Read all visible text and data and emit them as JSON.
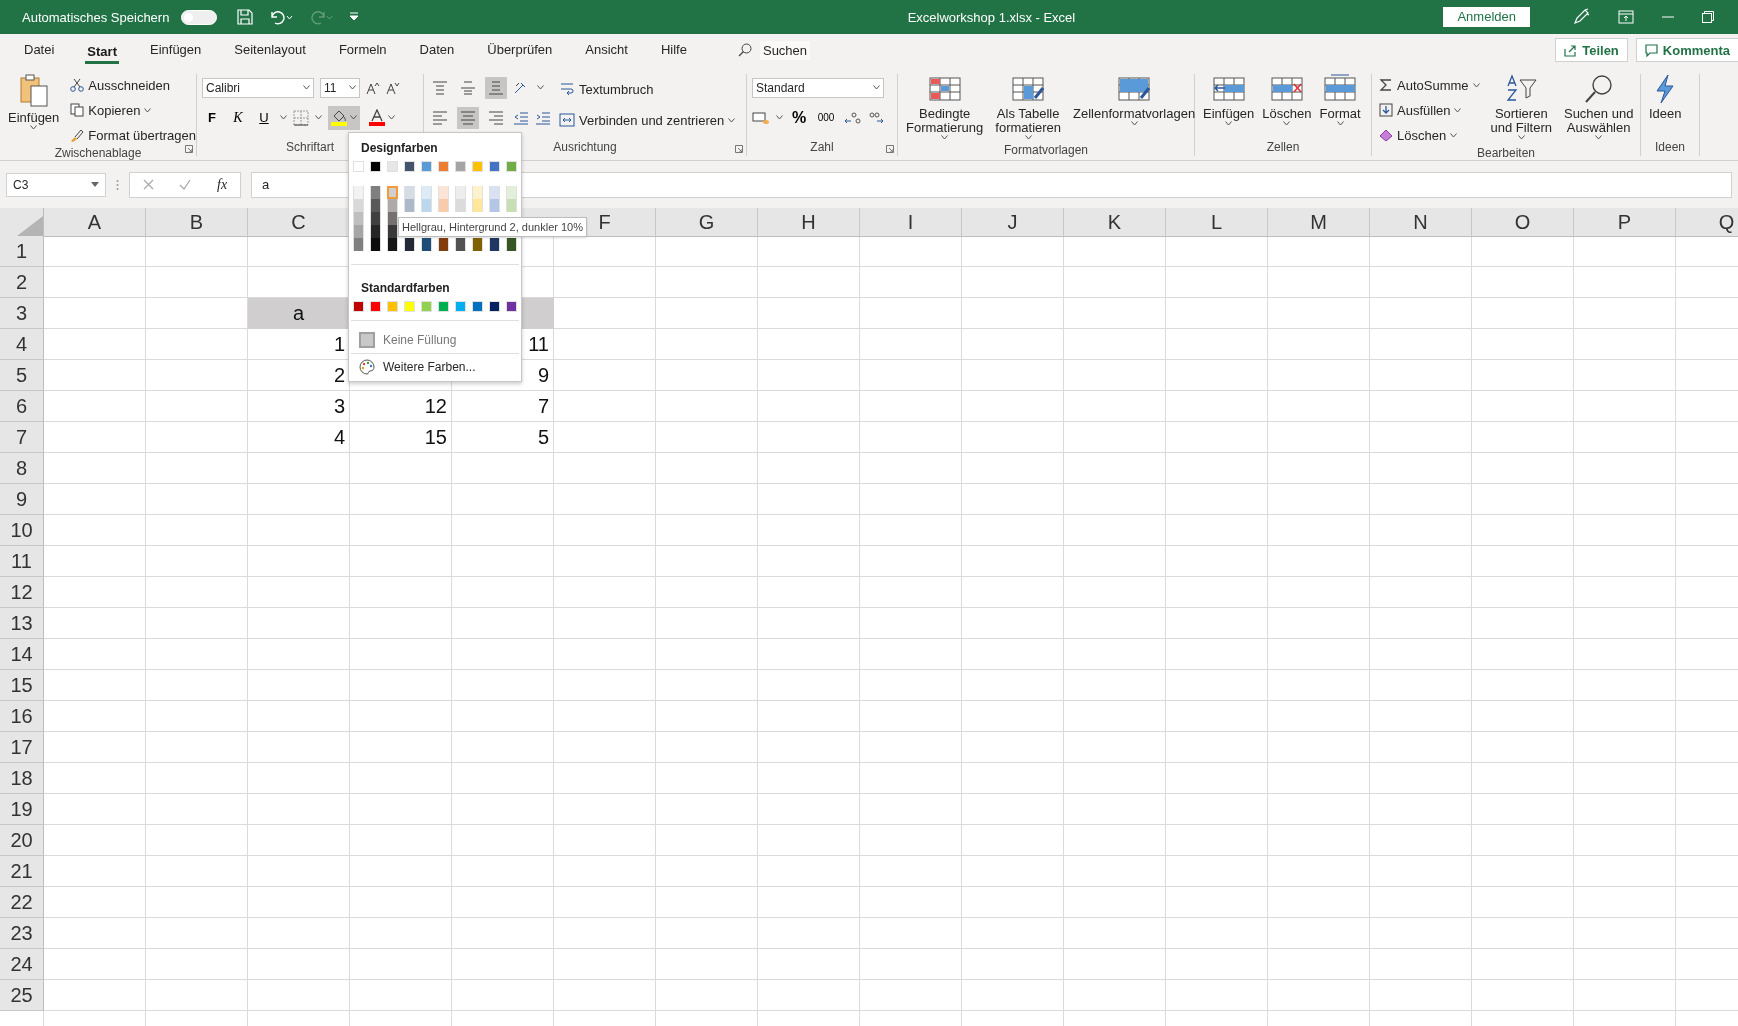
{
  "title_bar": {
    "autosave_label": "Automatisches Speichern",
    "autosave_on": false,
    "title": "Excelworkshop 1.xlsx  -  Excel",
    "sign_in": "Anmelden"
  },
  "menu_tabs": [
    {
      "label": "Datei",
      "selected": false
    },
    {
      "label": "Start",
      "selected": true
    },
    {
      "label": "Einfügen",
      "selected": false
    },
    {
      "label": "Seitenlayout",
      "selected": false
    },
    {
      "label": "Formeln",
      "selected": false
    },
    {
      "label": "Daten",
      "selected": false
    },
    {
      "label": "Überprüfen",
      "selected": false
    },
    {
      "label": "Ansicht",
      "selected": false
    },
    {
      "label": "Hilfe",
      "selected": false
    }
  ],
  "search": "Suchen",
  "share": "Teilen",
  "comments": "Kommenta",
  "ribbon": [
    {
      "kind": "clipboard",
      "label": "Zwischenablage",
      "paste": "Einfügen",
      "items": [
        "Ausschneiden",
        "Kopieren",
        "Format übertragen"
      ]
    },
    {
      "kind": "font",
      "label": "Schriftart",
      "font": "Calibri",
      "size": "11",
      "bold": "F",
      "italic": "K",
      "underline": "U",
      "fill_color": {
        "color": "#ffff00",
        "expanded": true
      },
      "font_color": {
        "color": "#ff0000"
      }
    },
    {
      "kind": "alignment",
      "label": "Ausrichtung",
      "vertical": [
        {
          "selected": false
        },
        {
          "selected": false
        },
        {
          "selected": true
        }
      ],
      "horizontal": [
        {
          "selected": false
        },
        {
          "selected": true
        },
        {
          "selected": false
        }
      ],
      "wrap": "Textumbruch",
      "merge": "Verbinden und zentrieren"
    },
    {
      "kind": "number",
      "label": "Zahl",
      "format": "Standard",
      "percent": "%",
      "thousands": "000"
    },
    {
      "kind": "styles",
      "label": "Formatvorlagen",
      "buttons": [
        "Bedingte\nFormatierung",
        "Als Tabelle\nformatieren",
        "Zellenformatvorlagen"
      ]
    },
    {
      "kind": "cells",
      "label": "Zellen",
      "buttons": [
        "Einfügen",
        "Löschen",
        "Format"
      ]
    },
    {
      "kind": "editing",
      "label": "Bearbeiten",
      "items": [
        "AutoSumme",
        "Ausfüllen",
        "Löschen"
      ],
      "buttons": [
        "Sortieren\nund Filtern",
        "Suchen und\nAuswählen"
      ]
    },
    {
      "kind": "ideas",
      "label": "Ideen",
      "buttons": [
        "Ideen"
      ]
    }
  ],
  "formula_bar": {
    "name_box": "C3",
    "function_label": "fx",
    "formula": "a"
  },
  "sheet": {
    "columns": [
      "A",
      "B",
      "C",
      null,
      null,
      "F",
      "G",
      "H",
      "I",
      "J",
      "K",
      "L",
      "M",
      "N",
      "O",
      "P",
      "Q"
    ],
    "rows": [
      {
        "number": "1"
      },
      {
        "number": "2"
      },
      {
        "number": "3",
        "cells": [
          null,
          null,
          {
            "value": "a",
            "kind": "text",
            "fill": true
          },
          null,
          {
            "fill": true
          }
        ]
      },
      {
        "number": "4",
        "cells": [
          null,
          null,
          {
            "value": "1",
            "kind": "number"
          },
          null,
          {
            "value": "11",
            "kind": "number"
          }
        ]
      },
      {
        "number": "5",
        "cells": [
          null,
          null,
          {
            "value": "2",
            "kind": "number"
          },
          null,
          {
            "value": "9",
            "kind": "number"
          }
        ]
      },
      {
        "number": "6",
        "cells": [
          null,
          null,
          {
            "value": "3",
            "kind": "number"
          },
          {
            "value": "12",
            "kind": "number"
          },
          {
            "value": "7",
            "kind": "number"
          }
        ]
      },
      {
        "number": "7",
        "cells": [
          null,
          null,
          {
            "value": "4",
            "kind": "number"
          },
          {
            "value": "15",
            "kind": "number"
          },
          {
            "value": "5",
            "kind": "number"
          }
        ]
      },
      {
        "number": "8"
      },
      {
        "number": "9"
      },
      {
        "number": "10"
      },
      {
        "number": "11"
      },
      {
        "number": "12"
      },
      {
        "number": "13"
      },
      {
        "number": "14"
      },
      {
        "number": "15"
      },
      {
        "number": "16"
      },
      {
        "number": "17"
      },
      {
        "number": "18"
      },
      {
        "number": "19"
      },
      {
        "number": "20"
      },
      {
        "number": "21"
      },
      {
        "number": "22"
      },
      {
        "number": "23"
      },
      {
        "number": "24"
      },
      {
        "number": "25"
      }
    ]
  },
  "color_menu": {
    "theme_title": "Designfarben",
    "theme_colors": [
      {
        "color": "#ffffff",
        "selected": false
      },
      {
        "color": "#000000",
        "selected": false
      },
      {
        "color": "#e7e6e6",
        "selected": false
      },
      {
        "color": "#44546a",
        "selected": false
      },
      {
        "color": "#5b9bd5",
        "selected": false
      },
      {
        "color": "#ed7d31",
        "selected": false
      },
      {
        "color": "#a5a5a5",
        "selected": false
      },
      {
        "color": "#ffc000",
        "selected": false
      },
      {
        "color": "#4472c4",
        "selected": false
      },
      {
        "color": "#70ad47",
        "selected": false
      }
    ],
    "shade_rows": [
      [
        {
          "color": "#f2f2f2",
          "selected": false
        },
        {
          "color": "#7f7f7f",
          "selected": false
        },
        {
          "color": "#d0cece",
          "selected": true
        },
        {
          "color": "#d6dce4",
          "selected": false
        },
        {
          "color": "#ddebf7",
          "selected": false
        },
        {
          "color": "#fce4d6",
          "selected": false
        },
        {
          "color": "#ededed",
          "selected": false
        },
        {
          "color": "#fff2cc",
          "selected": false
        },
        {
          "color": "#d9e1f2",
          "selected": false
        },
        {
          "color": "#e2efda",
          "selected": false
        }
      ],
      [
        {
          "color": "#d9d9d9",
          "selected": false
        },
        {
          "color": "#595959",
          "selected": false
        },
        {
          "color": "#aeaaaa",
          "selected": false
        },
        {
          "color": "#adb9ca",
          "selected": false
        },
        {
          "color": "#bdd7ee",
          "selected": false
        },
        {
          "color": "#f8cbad",
          "selected": false
        },
        {
          "color": "#dbdbdb",
          "selected": false
        },
        {
          "color": "#ffe699",
          "selected": false
        },
        {
          "color": "#b4c6e7",
          "selected": false
        },
        {
          "color": "#c6e0b4",
          "selected": false
        }
      ],
      [
        {
          "color": "#bfbfbf",
          "selected": false
        },
        {
          "color": "#404040",
          "selected": false
        },
        {
          "color": "#757171",
          "selected": false
        }
      ],
      [
        {
          "color": "#a6a6a6",
          "selected": false
        },
        {
          "color": "#262626",
          "selected": false
        },
        {
          "color": "#3a3838",
          "selected": false
        }
      ],
      [
        {
          "color": "#808080",
          "selected": false
        },
        {
          "color": "#0d0d0d",
          "selected": false
        },
        {
          "color": "#161616",
          "selected": false
        },
        {
          "color": "#222b35",
          "selected": false
        },
        {
          "color": "#1f4e78",
          "selected": false
        },
        {
          "color": "#833c0c",
          "selected": false
        },
        {
          "color": "#525252",
          "selected": false
        },
        {
          "color": "#806000",
          "selected": false
        },
        {
          "color": "#203764",
          "selected": false
        },
        {
          "color": "#375623",
          "selected": false
        }
      ]
    ],
    "standard_title": "Standardfarben",
    "standard_colors": [
      {
        "color": "#c00000",
        "selected": false
      },
      {
        "color": "#ff0000",
        "selected": false
      },
      {
        "color": "#ffc000",
        "selected": false
      },
      {
        "color": "#ffff00",
        "selected": false
      },
      {
        "color": "#92d050",
        "selected": false
      },
      {
        "color": "#00b050",
        "selected": false
      },
      {
        "color": "#00b0f0",
        "selected": false
      },
      {
        "color": "#0070c0",
        "selected": false
      },
      {
        "color": "#002060",
        "selected": false
      },
      {
        "color": "#7030a0",
        "selected": false
      }
    ],
    "items": [
      {
        "label": "Keine Füllung",
        "kind": "no-fill",
        "disabled": true
      },
      {
        "label": "Weitere Farben...",
        "kind": "more",
        "disabled": false
      }
    ],
    "tooltip": "Hellgrau, Hintergrund 2, dunkler 10%"
  }
}
